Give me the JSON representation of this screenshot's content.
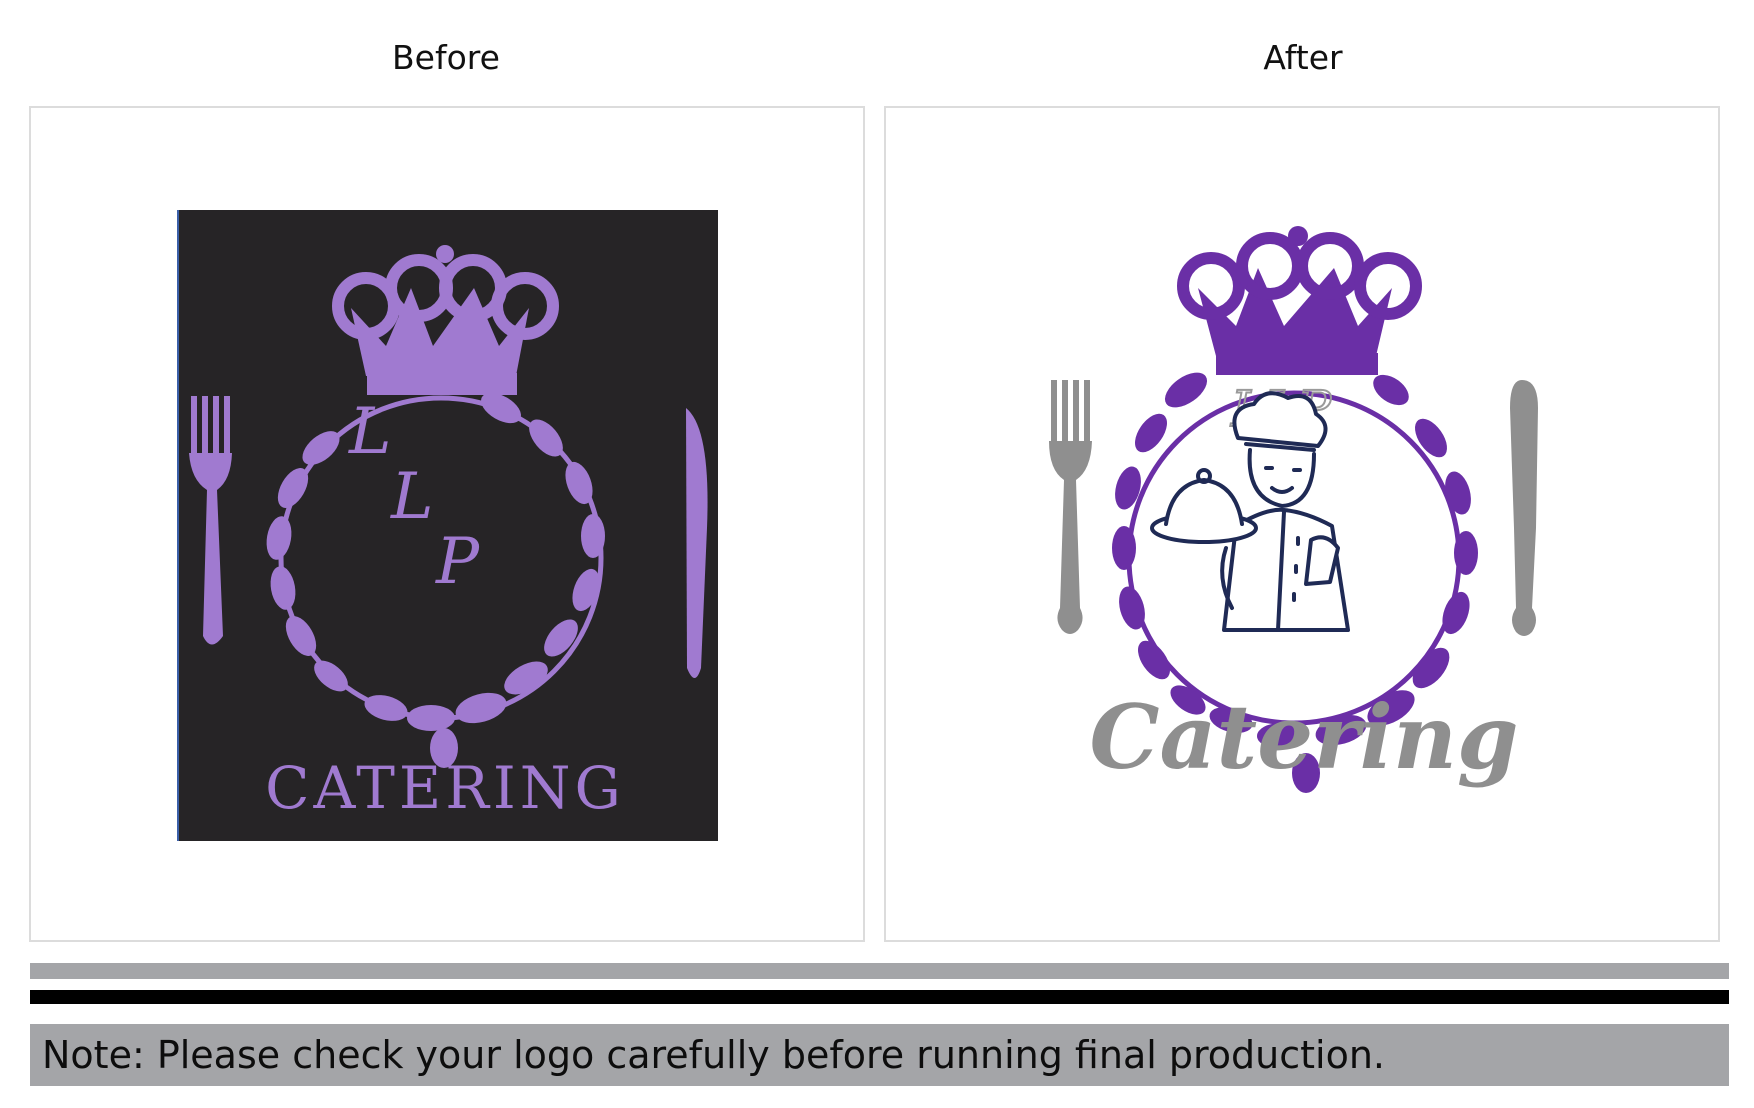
{
  "headings": {
    "before": "Before",
    "after": "After"
  },
  "before_logo": {
    "monogram": [
      "L",
      "L",
      "P"
    ],
    "wordmark": "CATERING"
  },
  "after_logo": {
    "monogram": "LLP",
    "wordmark": "Catering"
  },
  "note": "Note: Please check your logo carefully before running final production.",
  "colors": {
    "before_bg": "#262426",
    "before_purple": "#a07ad0",
    "after_purple": "#6a2fa6",
    "after_gray": "#8f8f8f",
    "chef_navy": "#1f2a55",
    "bar_gray": "#a4a5a8",
    "bar_black": "#000000"
  }
}
